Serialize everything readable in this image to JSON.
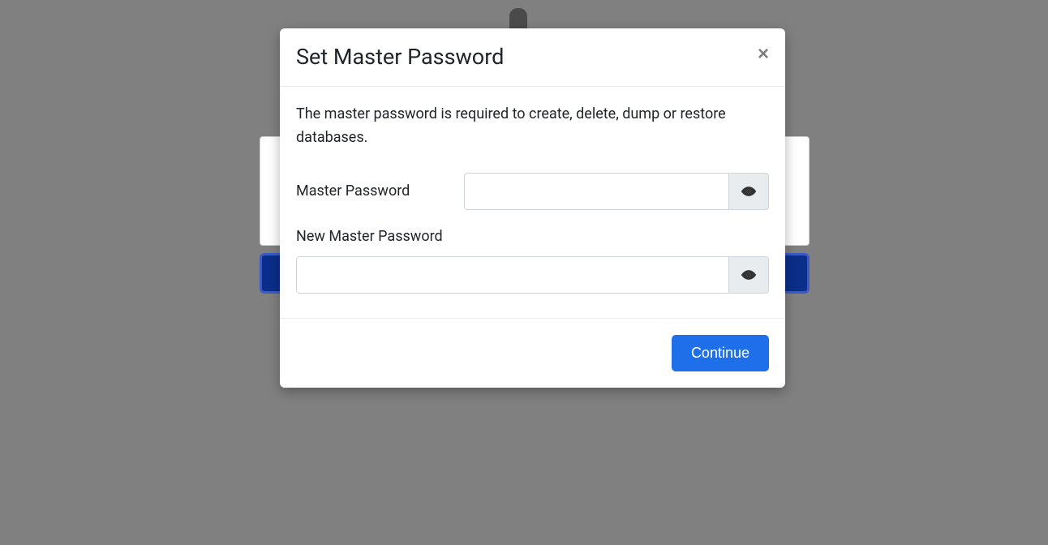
{
  "modal": {
    "title": "Set Master Password",
    "description": "The master password is required to create, delete, dump or restore databases.",
    "master_password_label": "Master Password",
    "new_master_password_label": "New Master Password",
    "master_password_value": "",
    "new_master_password_value": "",
    "continue_label": "Continue"
  }
}
